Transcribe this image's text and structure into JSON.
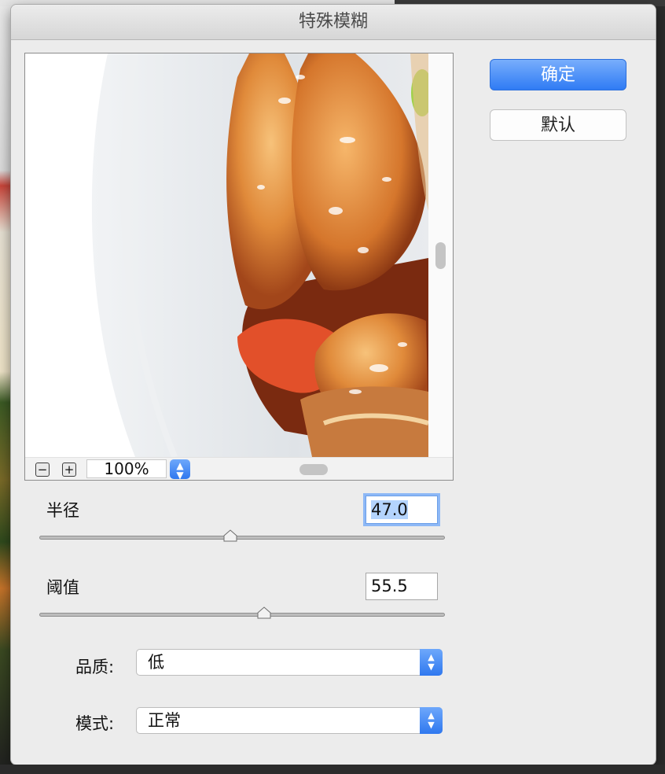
{
  "dialog": {
    "title": "特殊模糊"
  },
  "buttons": {
    "ok_label": "确定",
    "default_label": "默认"
  },
  "preview": {
    "zoom_out_label": "−",
    "zoom_in_label": "+",
    "zoom_value": "100%"
  },
  "params": {
    "radius": {
      "label": "半径",
      "value": "47.0",
      "slider_fraction": 0.47
    },
    "threshold": {
      "label": "阈值",
      "value": "55.5",
      "slider_fraction": 0.555
    }
  },
  "quality": {
    "label": "品质:",
    "selected": "低"
  },
  "mode": {
    "label": "模式:",
    "selected": "正常"
  },
  "colors": {
    "accent": "#2f7bf4",
    "focus_ring": "#8db8f6"
  }
}
